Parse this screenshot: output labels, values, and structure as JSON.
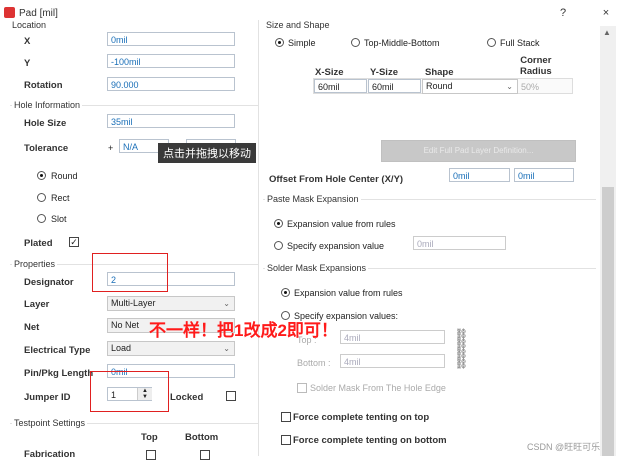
{
  "window": {
    "title": "Pad [mil]",
    "help": "?",
    "close": "×"
  },
  "location": {
    "section": "Location",
    "x_label": "X",
    "x_value": "0mil",
    "y_label": "Y",
    "y_value": "-100mil",
    "rotation_label": "Rotation",
    "rotation_value": "90.000"
  },
  "hole": {
    "section": "Hole Information",
    "size_label": "Hole Size",
    "size_value": "35mil",
    "tolerance_label": "Tolerance",
    "tol_plus_sign": "+",
    "tol_plus_value": "N/A",
    "round_label": "Round",
    "rect_label": "Rect",
    "slot_label": "Slot",
    "plated_label": "Plated",
    "plated_check": "✓"
  },
  "tooltip": "点击并拖拽以移动",
  "properties": {
    "section": "Properties",
    "designator_label": "Designator",
    "designator_value": "2",
    "layer_label": "Layer",
    "layer_value": "Multi-Layer",
    "net_label": "Net",
    "net_value": "No Net",
    "etype_label": "Electrical Type",
    "etype_value": "Load",
    "pinpkg_label": "Pin/Pkg Length",
    "pinpkg_value": "0mil",
    "jumper_label": "Jumper ID",
    "jumper_value": "1",
    "locked_label": "Locked"
  },
  "testpoint": {
    "section": "Testpoint Settings",
    "top_label": "Top",
    "bottom_label": "Bottom",
    "fabrication_label": "Fabrication"
  },
  "size_shape": {
    "section": "Size and Shape",
    "simple_label": "Simple",
    "tmb_label": "Top-Middle-Bottom",
    "full_label": "Full Stack",
    "col_xsize": "X-Size",
    "col_ysize": "Y-Size",
    "col_shape": "Shape",
    "col_corner": "Corner\nRadius",
    "row_xsize": "60mil",
    "row_ysize": "60mil",
    "row_shape": "Round",
    "row_corner": "50%",
    "edit_button": "Edit Full Pad Layer Definition..."
  },
  "offset": {
    "label": "Offset From Hole Center (X/Y)",
    "x_value": "0mil",
    "y_value": "0mil"
  },
  "paste": {
    "section": "Paste Mask Expansion",
    "rules_label": "Expansion value from rules",
    "specify_label": "Specify expansion value",
    "specify_value": "0mil"
  },
  "solder": {
    "section": "Solder Mask Expansions",
    "rules_label": "Expansion value from rules",
    "specify_label": "Specify expansion values:",
    "top_label": "Top :",
    "top_value": "4mil",
    "bottom_label": "Bottom :",
    "bottom_value": "4mil",
    "from_hole_label": "Solder Mask From The Hole Edge",
    "tent_top_label": "Force complete tenting on top",
    "tent_bottom_label": "Force complete tenting on bottom"
  },
  "annotation": "不一样！把1改成2即可！",
  "watermark": "CSDN @旺旺可乐"
}
